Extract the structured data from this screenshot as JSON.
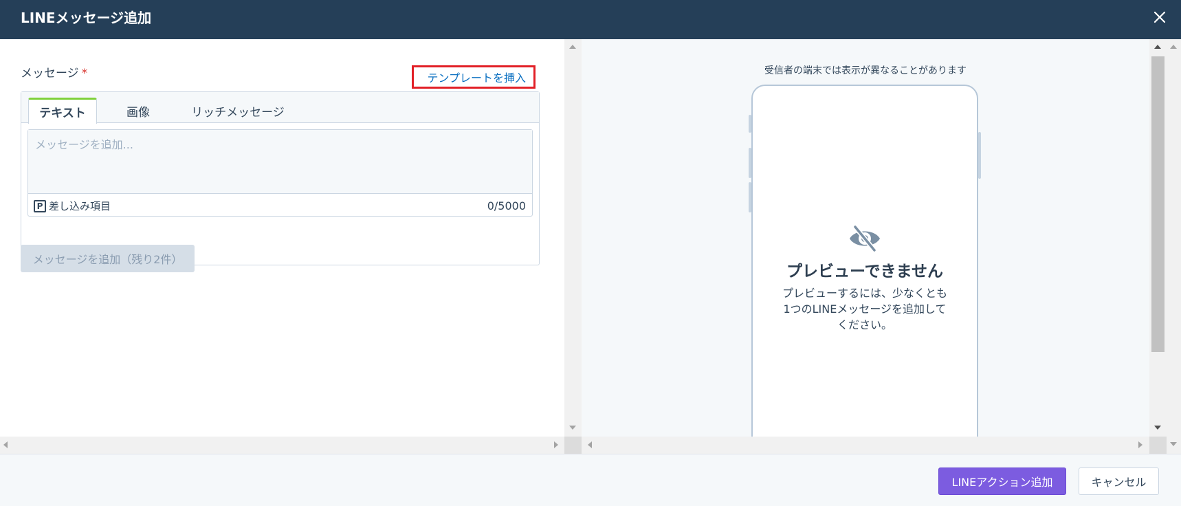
{
  "header": {
    "title": "LINEメッセージ追加",
    "close_icon": "close-icon"
  },
  "form": {
    "message_label": "メッセージ",
    "required_mark": "*",
    "template_link": "テンプレートを挿入",
    "tabs": [
      {
        "label": "テキスト",
        "active": true
      },
      {
        "label": "画像",
        "active": false
      },
      {
        "label": "リッチメッセージ",
        "active": false
      }
    ],
    "message_placeholder": "メッセージを追加...",
    "message_value": "",
    "insert_icon_glyph": "P",
    "insert_item_label": "差し込み項目",
    "char_counter": "0/5000",
    "add_message_button": "メッセージを追加（残り2件）"
  },
  "preview": {
    "note": "受信者の端末では表示が異なることがあります",
    "icon": "eye-slash-icon",
    "title": "プレビューできません",
    "text": "プレビューするには、少なくとも1つのLINEメッセージを追加してください。"
  },
  "footer": {
    "primary_button": "LINEアクション追加",
    "cancel_button": "キャンセル"
  },
  "colors": {
    "header_bg": "#253f58",
    "accent_purple": "#7c5ce0",
    "tab_active_border": "#7fd13b",
    "link_blue": "#0b70c1",
    "highlight_red": "#e21f26"
  }
}
